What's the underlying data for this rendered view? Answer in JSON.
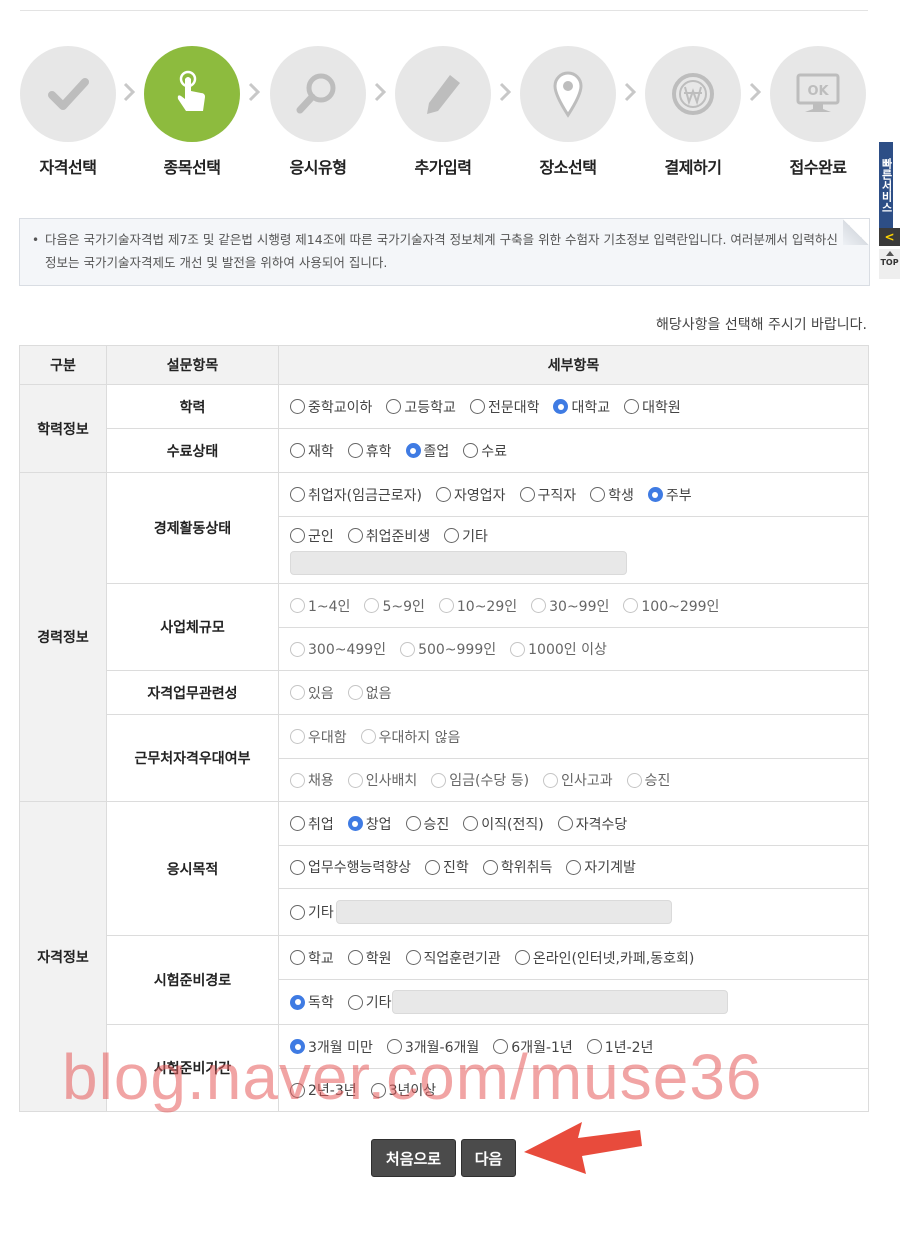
{
  "steps": [
    {
      "label": "자격선택",
      "icon": "check-icon",
      "active": false
    },
    {
      "label": "종목선택",
      "icon": "finger-touch-icon",
      "active": true
    },
    {
      "label": "응시유형",
      "icon": "magnifier-icon",
      "active": false
    },
    {
      "label": "추가입력",
      "icon": "pencil-icon",
      "active": false
    },
    {
      "label": "장소선택",
      "icon": "map-pin-icon",
      "active": false
    },
    {
      "label": "결제하기",
      "icon": "won-coin-icon",
      "active": false
    },
    {
      "label": "접수완료",
      "icon": "ok-monitor-icon",
      "active": false
    }
  ],
  "notice": {
    "bullet": "•",
    "text": "다음은 국가기술자격법 제7조 및 같은법 시행령 제14조에 따른 국가기술자격 정보체계 구축을 위한 수험자 기초정보 입력란입니다. 여러분께서 입력하신 정보는 국가기술자격제도 개선 및 발전을 위하여 사용되어 집니다."
  },
  "instruction": "해당사항을 선택해 주시기 바랍니다.",
  "side": {
    "quick": "빠른서비스",
    "chevron": "<",
    "top": "TOP"
  },
  "table": {
    "headers": {
      "category": "구분",
      "item": "설문항목",
      "detail": "세부항목"
    },
    "education": {
      "category": "학력정보",
      "level": {
        "label": "학력",
        "options": [
          "중학교이하",
          "고등학교",
          "전문대학",
          "대학교",
          "대학원"
        ],
        "selected": "대학교"
      },
      "status": {
        "label": "수료상태",
        "options": [
          "재학",
          "휴학",
          "졸업",
          "수료"
        ],
        "selected": "졸업"
      }
    },
    "career": {
      "category": "경력정보",
      "econ": {
        "label": "경제활동상태",
        "row1": [
          "취업자(임금근로자)",
          "자영업자",
          "구직자",
          "학생",
          "주부"
        ],
        "row2": [
          "군인",
          "취업준비생",
          "기타"
        ],
        "selected": "주부"
      },
      "size": {
        "label": "사업체규모",
        "row1": [
          "1~4인",
          "5~9인",
          "10~29인",
          "30~99인",
          "100~299인"
        ],
        "row2": [
          "300~499인",
          "500~999인",
          "1000인 이상"
        ]
      },
      "relevance": {
        "label": "자격업무관련성",
        "options": [
          "있음",
          "없음"
        ]
      },
      "preference": {
        "label": "근무처자격우대여부",
        "row1": [
          "우대함",
          "우대하지 않음"
        ],
        "row2": [
          "채용",
          "인사배치",
          "임금(수당 등)",
          "인사고과",
          "승진"
        ]
      }
    },
    "qual": {
      "category": "자격정보",
      "purpose": {
        "label": "응시목적",
        "row1": [
          "취업",
          "창업",
          "승진",
          "이직(전직)",
          "자격수당"
        ],
        "row2": [
          "업무수행능력향상",
          "진학",
          "학위취득",
          "자기계발"
        ],
        "row3": [
          "기타"
        ],
        "selected": "창업"
      },
      "route": {
        "label": "시험준비경로",
        "row1": [
          "학교",
          "학원",
          "직업훈련기관",
          "온라인(인터넷,카페,동호회)"
        ],
        "row2": [
          "독학",
          "기타"
        ],
        "selected": "독학"
      },
      "period": {
        "label": "시험준비기간",
        "row1": [
          "3개월 미만",
          "3개월-6개월",
          "6개월-1년",
          "1년-2년"
        ],
        "row2": [
          "2년-3년",
          "3년이상"
        ],
        "selected": "3개월 미만"
      }
    }
  },
  "buttons": {
    "first": "처음으로",
    "next": "다음"
  },
  "watermark": "blog.naver.com/muse36",
  "colors": {
    "active_step": "#8dbb3e",
    "radio_selected": "#3f7be3",
    "annotation_arrow": "#e84b3c"
  }
}
